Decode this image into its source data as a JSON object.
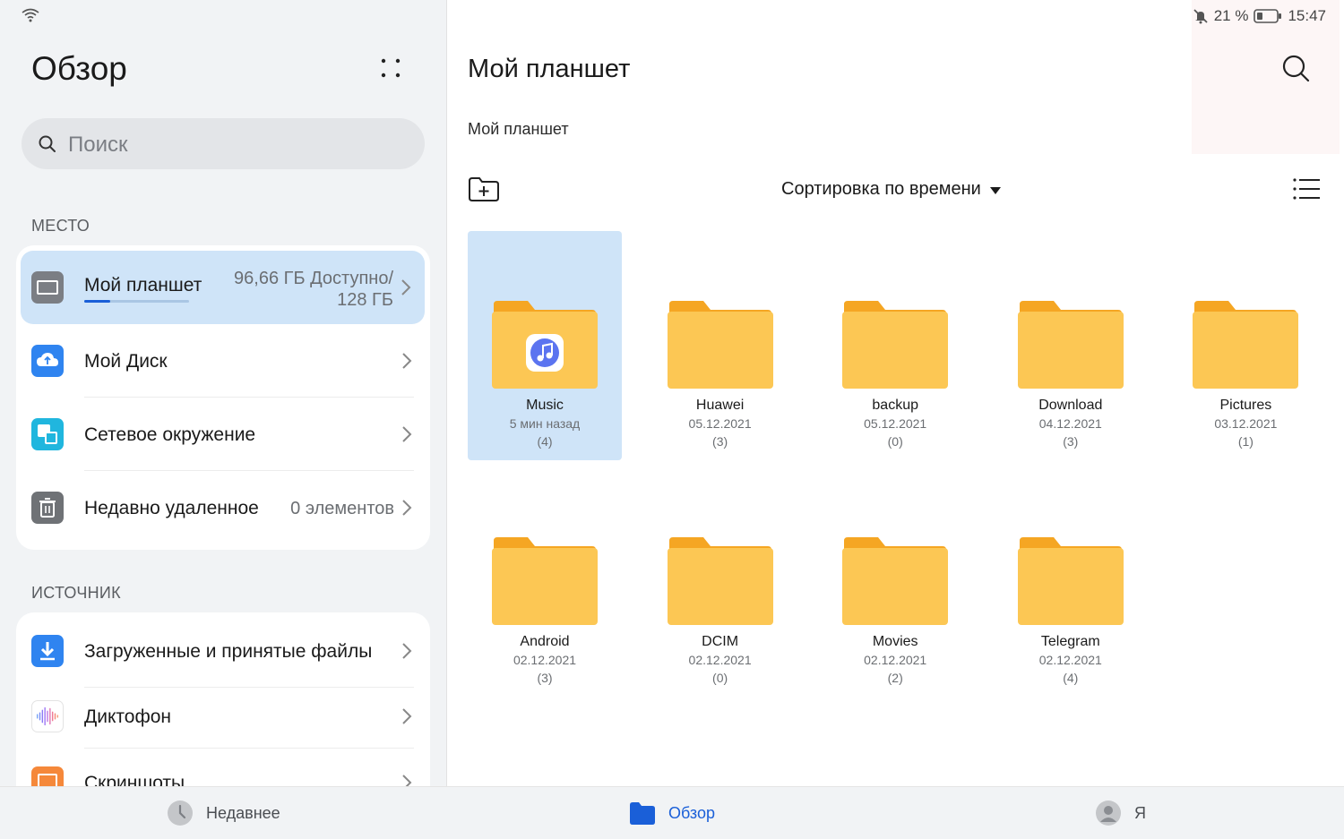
{
  "status": {
    "battery": "21 %",
    "time": "15:47"
  },
  "left": {
    "title": "Обзор",
    "search_placeholder": "Поиск",
    "section_place": "МЕСТО",
    "section_source": "ИСТОЧНИК",
    "storage": {
      "label": "Мой планшет",
      "available_line1": "96,66 ГБ Доступно/",
      "available_line2": "128 ГБ",
      "used_fraction": 0.25
    },
    "place_items": [
      {
        "label": "Мой Диск"
      },
      {
        "label": "Сетевое окружение"
      },
      {
        "label": "Недавно удаленное",
        "extra": "0 элементов"
      }
    ],
    "source_items": [
      {
        "label": "Загруженные и принятые файлы"
      },
      {
        "label": "Диктофон"
      },
      {
        "label": "Скриншоты"
      }
    ]
  },
  "right": {
    "title": "Мой планшет",
    "breadcrumb": "Мой планшет",
    "sort_label": "Сортировка по времени",
    "folders": [
      {
        "name": "Music",
        "date": "5 мин назад",
        "count": "(4)"
      },
      {
        "name": "Huawei",
        "date": "05.12.2021",
        "count": "(3)"
      },
      {
        "name": "backup",
        "date": "05.12.2021",
        "count": "(0)"
      },
      {
        "name": "Download",
        "date": "04.12.2021",
        "count": "(3)"
      },
      {
        "name": "Pictures",
        "date": "03.12.2021",
        "count": "(1)"
      },
      {
        "name": "Android",
        "date": "02.12.2021",
        "count": "(3)"
      },
      {
        "name": "DCIM",
        "date": "02.12.2021",
        "count": "(0)"
      },
      {
        "name": "Movies",
        "date": "02.12.2021",
        "count": "(2)"
      },
      {
        "name": "Telegram",
        "date": "02.12.2021",
        "count": "(4)"
      }
    ]
  },
  "nav": {
    "recent": "Недавнее",
    "browse": "Обзор",
    "me": "Я"
  },
  "colors": {
    "accent": "#1a5fd8",
    "selected_bg": "#cfe4f8",
    "folder": "#fcc754",
    "folder_tab": "#f5a623"
  }
}
